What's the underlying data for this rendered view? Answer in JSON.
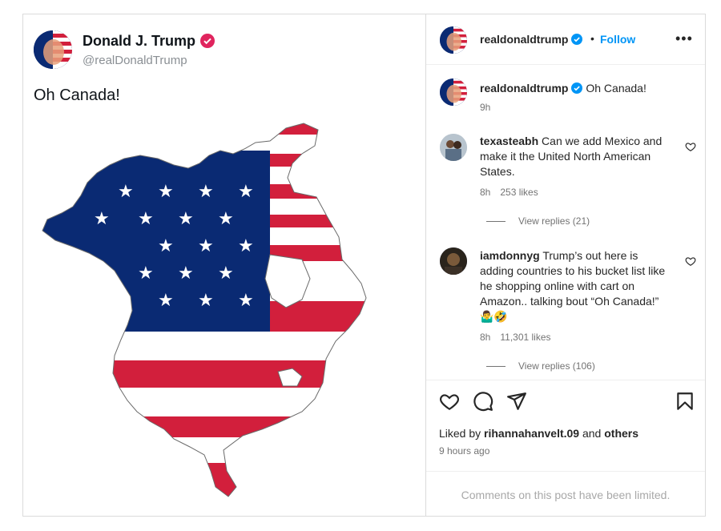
{
  "tweet": {
    "display_name": "Donald J. Trump",
    "handle": "@realDonaldTrump",
    "text": "Oh Canada!"
  },
  "post": {
    "username": "realdonaldtrump",
    "separator": "•",
    "follow_label": "Follow",
    "more_label": "•••",
    "caption_user": "realdonaldtrump",
    "caption_text": "Oh Canada!",
    "caption_time": "9h",
    "comments": [
      {
        "user": "texasteabh",
        "text": "Can we add Mexico and make it the United North American States.",
        "time": "8h",
        "likes": "253 likes",
        "replies": "View replies (21)"
      },
      {
        "user": "iamdonnyg",
        "text": "Trump’s out here is adding countries to his bucket list like he shopping online with cart on Amazon.. talking bout “Oh Canada!” 🤷‍♂️🤣",
        "time": "8h",
        "likes": "11,301 likes",
        "replies": "View replies (106)"
      }
    ],
    "liked_prefix": "Liked by",
    "liked_user": "rihannahanvelt.09",
    "liked_and": "and",
    "liked_others": "others",
    "ago": "9 hours ago",
    "limited": "Comments on this post have been limited."
  },
  "colors": {
    "verified_tw": "#e0245e",
    "verified_ig": "#0095f6",
    "flag_blue": "#0a2a73",
    "flag_red": "#d21f3c"
  }
}
